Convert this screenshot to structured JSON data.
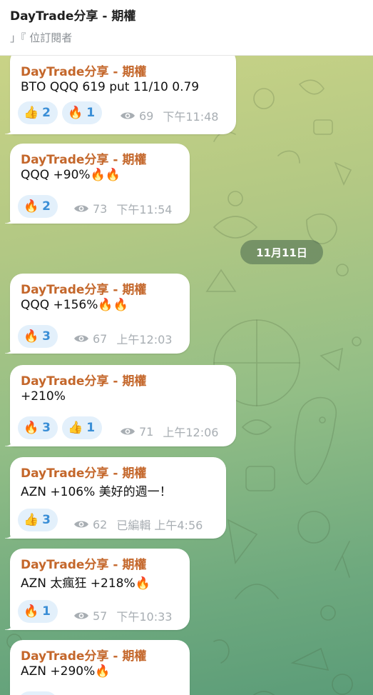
{
  "header": {
    "title": "DayTrade分享 - 期權",
    "subscribers": "」『 位訂閱者"
  },
  "date_divider": "11月11日",
  "icons": {
    "views": "eye-icon",
    "thumbs_up": "👍",
    "fire": "🔥"
  },
  "messages": [
    {
      "sender": "DayTrade分享 - 期權",
      "text": "BTO QQQ 619 put 11/10 0.79",
      "reactions": [
        {
          "emoji": "👍",
          "count": "2"
        },
        {
          "emoji": "🔥",
          "count": "1"
        }
      ],
      "views": "69",
      "edited": "",
      "time": "下午11:48"
    },
    {
      "sender": "DayTrade分享 - 期權",
      "text": "QQQ +90%🔥🔥",
      "reactions": [
        {
          "emoji": "🔥",
          "count": "2"
        }
      ],
      "views": "73",
      "edited": "",
      "time": "下午11:54"
    },
    {
      "sender": "DayTrade分享 - 期權",
      "text": "QQQ +156%🔥🔥",
      "reactions": [
        {
          "emoji": "🔥",
          "count": "3"
        }
      ],
      "views": "67",
      "edited": "",
      "time": "上午12:03"
    },
    {
      "sender": "DayTrade分享 - 期權",
      "text": "+210%",
      "reactions": [
        {
          "emoji": "🔥",
          "count": "3"
        },
        {
          "emoji": "👍",
          "count": "1"
        }
      ],
      "views": "71",
      "edited": "",
      "time": "上午12:06"
    },
    {
      "sender": "DayTrade分享 - 期權",
      "text": "AZN +106% 美好的週一！",
      "reactions": [
        {
          "emoji": "👍",
          "count": "3"
        }
      ],
      "views": "62",
      "edited": "已編輯",
      "time": "上午4:56"
    },
    {
      "sender": "DayTrade分享 - 期權",
      "text": "AZN 太瘋狂 +218%🔥",
      "reactions": [
        {
          "emoji": "🔥",
          "count": "1"
        }
      ],
      "views": "57",
      "edited": "",
      "time": "下午10:33"
    },
    {
      "sender": "DayTrade分享 - 期權",
      "text": "AZN +290%🔥",
      "reactions": [],
      "views": "",
      "edited": "",
      "time": ""
    }
  ]
}
